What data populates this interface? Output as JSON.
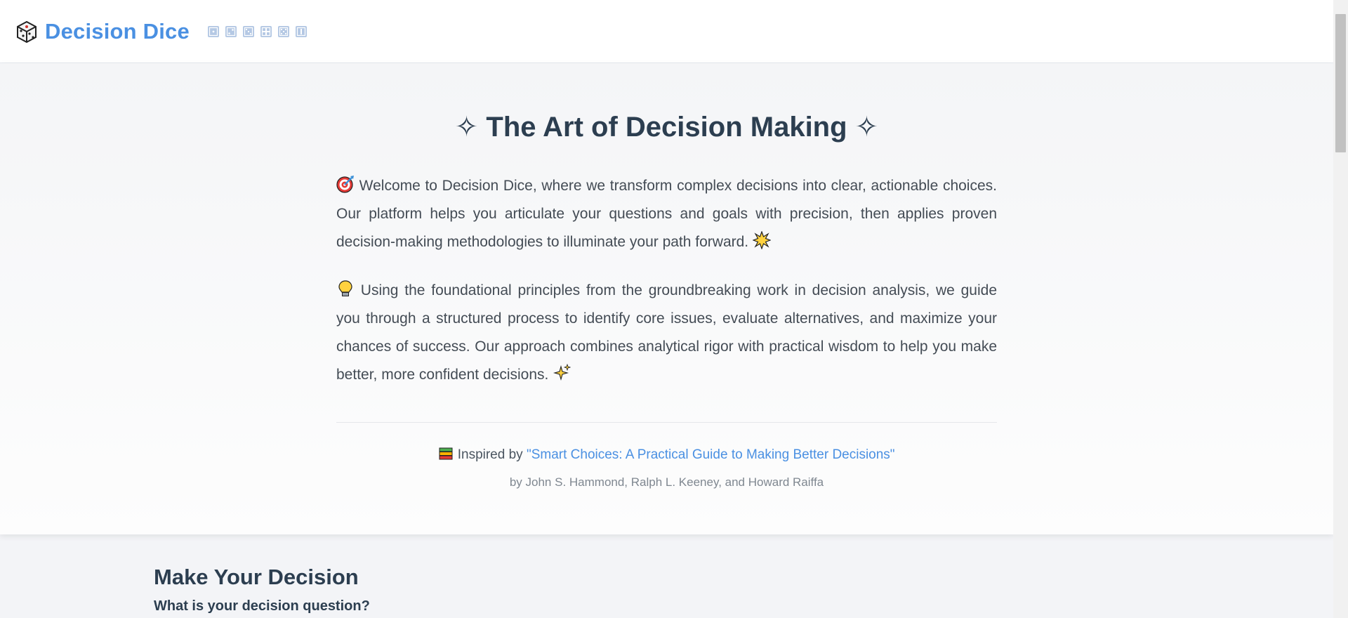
{
  "header": {
    "brand": "Decision Dice",
    "logo_icon": "die-icon",
    "dice_icons": [
      "die-face-1-icon",
      "die-face-2-icon",
      "die-face-3-icon",
      "die-face-4-icon",
      "die-face-5-icon",
      "die-face-6-icon"
    ]
  },
  "hero": {
    "title": "✧ The Art of Decision Making ✧",
    "paragraph1": "Welcome to Decision Dice, where we transform complex decisions into clear, actionable choices. Our platform helps you articulate your questions and goals with precision, then applies proven decision-making methodologies to illuminate your path forward.",
    "paragraph2": "Using the foundational principles from the groundbreaking work in decision analysis, we guide you through a structured process to identify core issues, evaluate alternatives, and maximize your chances of success. Our approach combines analytical rigor with practical wisdom to help you make better, more confident decisions.",
    "inspired_prefix": "Inspired by",
    "book_title": "\"Smart Choices: A Practical Guide to Making Better Decisions\"",
    "byline": "by John S. Hammond, Ralph L. Keeney, and Howard Raiffa"
  },
  "main": {
    "section_title": "Make Your Decision",
    "question_label": "What is your decision question?"
  },
  "colors": {
    "brand": "#4a90e2",
    "heading": "#2c3e50",
    "body_text": "#444c55"
  }
}
